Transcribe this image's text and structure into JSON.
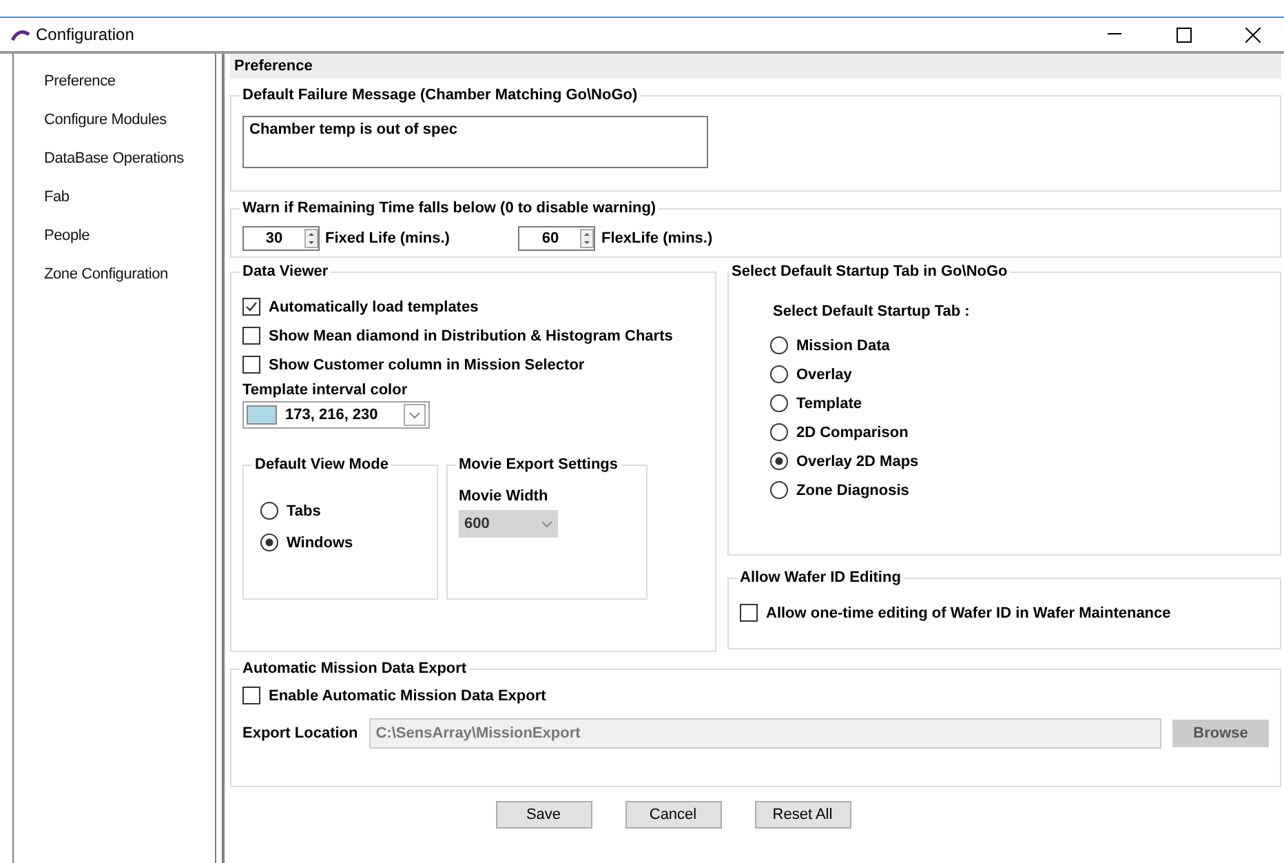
{
  "window": {
    "title": "Configuration"
  },
  "sidebar": {
    "items": [
      {
        "label": "Preference"
      },
      {
        "label": "Configure Modules"
      },
      {
        "label": "DataBase Operations"
      },
      {
        "label": "Fab"
      },
      {
        "label": "People"
      },
      {
        "label": "Zone Configuration"
      }
    ]
  },
  "page_title": "Preference",
  "failure_message": {
    "title": "Default Failure Message (Chamber Matching Go\\NoGo)",
    "value": "Chamber temp is out of spec"
  },
  "warn": {
    "title": "Warn if Remaining Time falls below (0 to disable warning)",
    "fields": [
      {
        "value": "30",
        "label": "Fixed Life (mins.)"
      },
      {
        "value": "60",
        "label": "FlexLife (mins.)"
      }
    ]
  },
  "data_viewer": {
    "title": "Data Viewer",
    "options": [
      {
        "label": "Automatically load templates",
        "checked": true
      },
      {
        "label": "Show Mean diamond in Distribution & Histogram Charts",
        "checked": false
      },
      {
        "label": "Show Customer column in Mission Selector",
        "checked": false
      }
    ],
    "color_label": "Template interval color",
    "color": {
      "value": "173, 216, 230",
      "color": "#add8e6"
    },
    "view_mode": {
      "title": "Default View Mode",
      "options": [
        {
          "label": "Tabs",
          "selected": false
        },
        {
          "label": "Windows",
          "selected": true
        }
      ]
    },
    "movie": {
      "title": "Movie Export Settings",
      "label": "Movie Width",
      "value": "600",
      "disabled": true
    }
  },
  "startup_tab": {
    "title": "Select Default Startup Tab in Go\\NoGo",
    "label": "Select Default Startup Tab :",
    "options": [
      {
        "label": "Mission Data",
        "selected": false
      },
      {
        "label": "Overlay",
        "selected": false
      },
      {
        "label": "Template",
        "selected": false
      },
      {
        "label": "2D Comparison",
        "selected": false
      },
      {
        "label": "Overlay 2D Maps",
        "selected": true
      },
      {
        "label": "Zone Diagnosis",
        "selected": false
      }
    ]
  },
  "wafer_id": {
    "title": "Allow Wafer ID Editing",
    "option": {
      "label": "Allow one-time editing of Wafer ID in Wafer Maintenance",
      "checked": false
    }
  },
  "export": {
    "title": "Automatic Mission Data Export",
    "option": {
      "label": "Enable Automatic Mission Data Export",
      "checked": false
    },
    "location_label": "Export Location",
    "location": "C:\\SensArray\\MissionExport",
    "disabled": true,
    "browse": "Browse"
  },
  "buttons": [
    "Save",
    "Cancel",
    "Reset All"
  ]
}
